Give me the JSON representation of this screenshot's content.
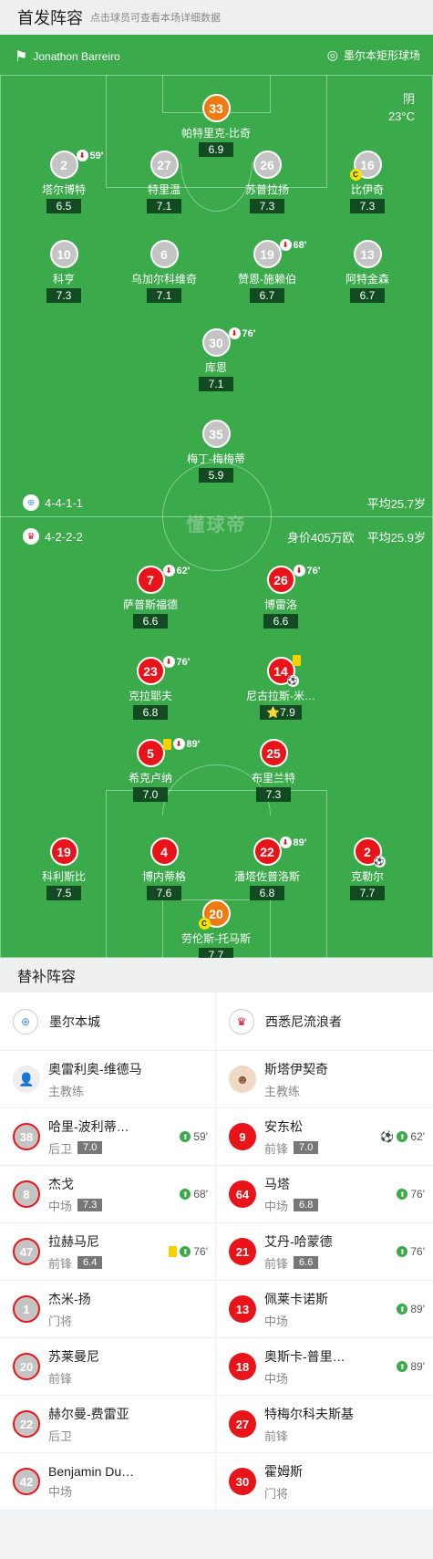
{
  "header": {
    "title": "首发阵容",
    "subtitle": "点击球员可查看本场详细数据"
  },
  "pitch": {
    "referee": "Jonathon Barreiro",
    "stadium": "墨尔本矩形球场",
    "weather": "阴",
    "temp": "23°C",
    "watermark": "懂球帝"
  },
  "home": {
    "formation": "4-4-1-1",
    "avg_age": "平均25.7岁"
  },
  "away": {
    "formation": "4-2-2-2",
    "value": "身价405万欧",
    "avg_age": "平均25.9岁"
  },
  "home_players": [
    {
      "num": "33",
      "name": "帕特里克-比奇",
      "rating": "6.9"
    },
    {
      "num": "2",
      "name": "塔尔博特",
      "rating": "6.5",
      "sub": "59'"
    },
    {
      "num": "27",
      "name": "特里温",
      "rating": "7.1"
    },
    {
      "num": "26",
      "name": "苏普拉扬",
      "rating": "7.3"
    },
    {
      "num": "16",
      "name": "比伊奇",
      "rating": "7.3"
    },
    {
      "num": "10",
      "name": "科亨",
      "rating": "7.3"
    },
    {
      "num": "6",
      "name": "乌加尔科维奇",
      "rating": "7.1"
    },
    {
      "num": "19",
      "name": "赞恩-施赖伯",
      "rating": "6.7",
      "sub": "68'"
    },
    {
      "num": "13",
      "name": "阿特金森",
      "rating": "6.7"
    },
    {
      "num": "30",
      "name": "库恩",
      "rating": "7.1",
      "sub": "76'"
    },
    {
      "num": "35",
      "name": "梅丁-梅梅蒂",
      "rating": "5.9"
    }
  ],
  "away_players": [
    {
      "num": "7",
      "name": "萨普斯福德",
      "rating": "6.6",
      "sub": "62'"
    },
    {
      "num": "26",
      "name": "博雷洛",
      "rating": "6.6",
      "sub": "76'"
    },
    {
      "num": "23",
      "name": "克拉耶夫",
      "rating": "6.8",
      "sub": "76'"
    },
    {
      "num": "14",
      "name": "尼古拉斯-米…",
      "rating": "7.9"
    },
    {
      "num": "5",
      "name": "希克卢纳",
      "rating": "7.0",
      "sub": "89'"
    },
    {
      "num": "25",
      "name": "布里兰特",
      "rating": "7.3"
    },
    {
      "num": "19",
      "name": "科利斯比",
      "rating": "7.5"
    },
    {
      "num": "4",
      "name": "博内蒂格",
      "rating": "7.6"
    },
    {
      "num": "22",
      "name": "潘塔佐普洛斯",
      "rating": "6.8",
      "sub": "89'"
    },
    {
      "num": "2",
      "name": "克勒尔",
      "rating": "7.7"
    },
    {
      "num": "20",
      "name": "劳伦斯-托马斯",
      "rating": "7.7"
    }
  ],
  "subs_title": "替补阵容",
  "teams": {
    "home": "墨尔本城",
    "away": "西悉尼流浪者"
  },
  "coaches": {
    "home": {
      "name": "奥雷利奥-维德马",
      "role": "主教练"
    },
    "away": {
      "name": "斯塔伊契奇",
      "role": "主教练"
    }
  },
  "subs": [
    {
      "h": {
        "num": "38",
        "name": "哈里-波利蒂…",
        "pos": "后卫",
        "rating": "7.0",
        "ev": "59'"
      },
      "a": {
        "num": "9",
        "name": "安东松",
        "pos": "前锋",
        "rating": "7.0",
        "ev": "62'"
      }
    },
    {
      "h": {
        "num": "8",
        "name": "杰戈",
        "pos": "中场",
        "rating": "7.3",
        "ev": "68'"
      },
      "a": {
        "num": "64",
        "name": "马塔",
        "pos": "中场",
        "rating": "6.8",
        "ev": "76'"
      }
    },
    {
      "h": {
        "num": "47",
        "name": "拉赫马尼",
        "pos": "前锋",
        "rating": "6.4",
        "ev": "76'"
      },
      "a": {
        "num": "21",
        "name": "艾丹-哈蒙德",
        "pos": "前锋",
        "rating": "6.6",
        "ev": "76'"
      }
    },
    {
      "h": {
        "num": "1",
        "name": "杰米-扬",
        "pos": "门将"
      },
      "a": {
        "num": "13",
        "name": "佩莱卡诺斯",
        "pos": "中场",
        "ev": "89'"
      }
    },
    {
      "h": {
        "num": "20",
        "name": "苏莱曼尼",
        "pos": "前锋"
      },
      "a": {
        "num": "18",
        "name": "奥斯卡-普里…",
        "pos": "中场",
        "ev": "89'"
      }
    },
    {
      "h": {
        "num": "22",
        "name": "赫尔曼-费雷亚",
        "pos": "后卫"
      },
      "a": {
        "num": "27",
        "name": "特梅尔科夫斯基",
        "pos": "前锋"
      }
    },
    {
      "h": {
        "num": "42",
        "name": "Benjamin Du…",
        "pos": "中场"
      },
      "a": {
        "num": "30",
        "name": "霍姆斯",
        "pos": "门将"
      }
    }
  ]
}
